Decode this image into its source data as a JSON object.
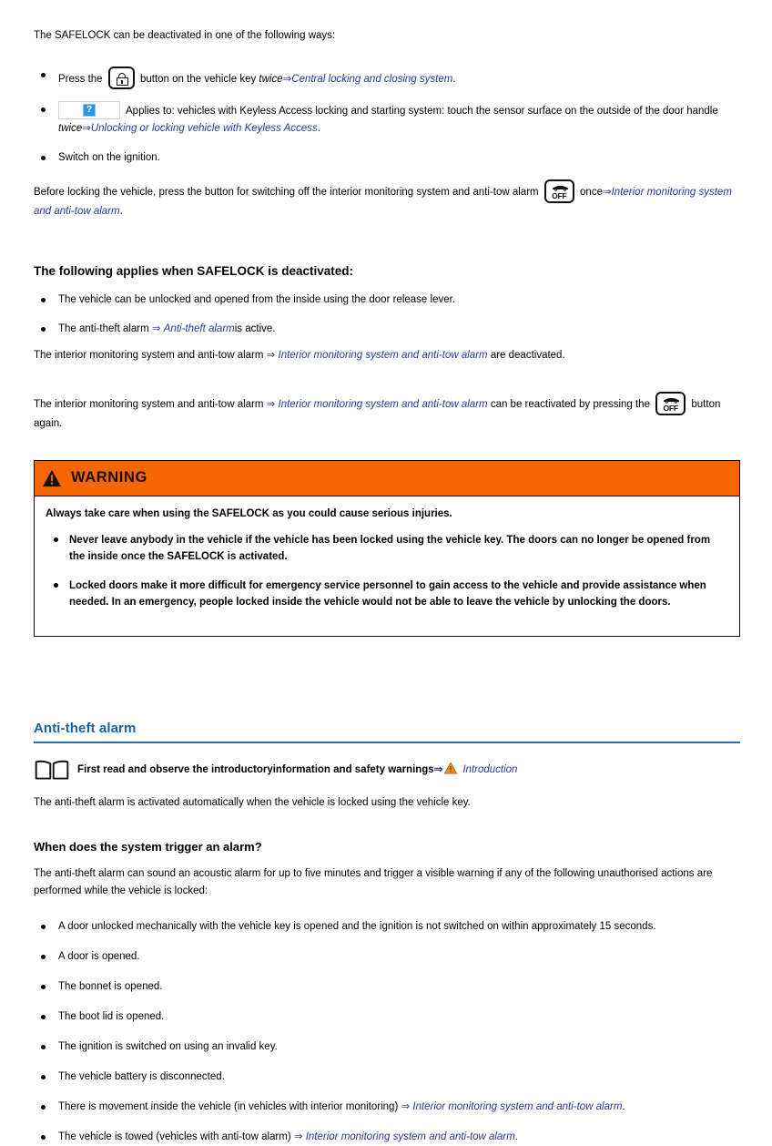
{
  "colors": {
    "warning_orange": "#f96500",
    "link_blue": "#2b36a0",
    "heading_blue": "#1763a6",
    "rule_blue": "#2a6fb0",
    "placeholder_blue": "#2f93e0"
  },
  "intro": {
    "lead": "The SAFELOCK can be deactivated in one of the following ways:",
    "bullets": {
      "key_press": {
        "before": "Press the",
        "after": "button on the vehicle key",
        "emphasis": "twice",
        "arrow": "⇒",
        "xref": "Central locking and closing system",
        "period": "."
      },
      "keyless": {
        "text": "Applies to: vehicles with Keyless Access locking and starting system: touch the sensor surface on the outside of the door handle",
        "emphasis": "twice",
        "arrow": "⇒",
        "xref": "Unlocking or locking vehicle with Keyless Access",
        "period": "."
      },
      "ignition": "Switch on the ignition."
    },
    "before_locking": {
      "text_before": "Before locking the vehicle, press the button for switching off the interior monitoring system and anti-tow alarm",
      "after_icon": "once",
      "arrow": "⇒",
      "xref": "Interior monitoring system and anti-tow alarm",
      "period": "."
    }
  },
  "deactivated_section": {
    "heading": "The following applies when SAFELOCK is deactivated:",
    "bullets": [
      {
        "text": "The vehicle can be unlocked and opened from the inside using the door release lever."
      },
      {
        "before": "The anti-theft alarm",
        "arrow": "⇒",
        "xref": "Anti-theft alarm",
        "after": "is active."
      }
    ],
    "para_deactivated": {
      "before": "The interior monitoring system and anti-tow alarm",
      "arrow": "⇒",
      "xref": "Interior monitoring system and anti-tow alarm",
      "after": "are deactivated."
    },
    "para_reactivated": {
      "before": "The interior monitoring system and anti-tow alarm",
      "arrow": "⇒",
      "xref": "Interior monitoring system and anti-tow alarm",
      "middle": "can be reactivated by pressing the",
      "after": "button again."
    }
  },
  "warning_box": {
    "title": "WARNING",
    "lead": "Always take care when using the SAFELOCK as you could cause serious injuries.",
    "bullets": [
      "Never leave anybody in the vehicle if the vehicle has been locked using the vehicle key. The doors can no longer be opened from the inside once the SAFELOCK is activated.",
      "Locked doors make it more difficult for emergency service personnel to gain access to the vehicle and provide assistance when needed. In an emergency, people locked inside the vehicle would not be able to leave the vehicle by unlocking the doors."
    ]
  },
  "antitheft_section": {
    "heading": "Anti-theft alarm",
    "booknote": {
      "text": "First read and observe the introductoryinformation and safety warnings",
      "arrow": "⇒",
      "xref": "Introduction"
    },
    "intro_para": "The anti-theft alarm is activated automatically when the vehicle is locked using the vehicle key.",
    "subheading": "When does the system trigger an alarm?",
    "body_para": "The anti-theft alarm can sound an acoustic alarm for up to five minutes and trigger a visible warning if any of the following unauthorised actions are performed while the vehicle is locked:",
    "trigger_bullets": [
      {
        "text": "A door unlocked mechanically with the vehicle key is opened and the ignition is not switched on within approximately 15 seconds."
      },
      {
        "text": "A door is opened."
      },
      {
        "text": "The bonnet is opened."
      },
      {
        "text": "The boot lid is opened."
      },
      {
        "text": "The ignition is switched on using an invalid key."
      },
      {
        "text": "The vehicle battery is disconnected."
      },
      {
        "before": "There is movement inside the vehicle (in vehicles with interior monitoring)",
        "arrow": "⇒",
        "xref": "Interior monitoring system and anti-tow alarm",
        "after": "."
      },
      {
        "before": "The vehicle is towed (vehicles with anti-tow alarm)",
        "arrow": "⇒",
        "xref": "Interior monitoring system and anti-tow alarm",
        "after": "."
      }
    ]
  },
  "icons": {
    "lock_button": "lock-button-icon",
    "image_placeholder": "missing-image-placeholder-icon",
    "placeholder_glyph": "?",
    "interior_off_button": "interior-monitoring-off-button-icon",
    "interior_off_label": "OFF",
    "warning_triangle": "warning-triangle-icon",
    "book": "open-book-icon"
  }
}
